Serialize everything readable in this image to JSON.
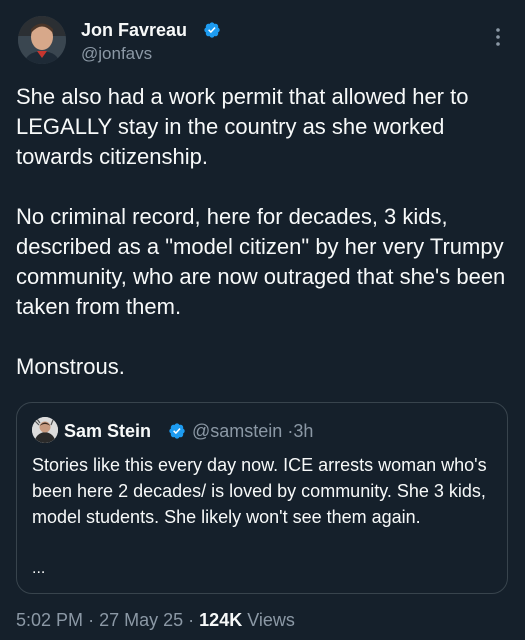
{
  "author": {
    "name": "Jon Favreau",
    "handle": "@jonfavs",
    "avatar_icon": "profile-photo",
    "verified_icon": "verified-badge-icon"
  },
  "tweet": {
    "paragraphs": [
      "She also had a work permit that allowed her to LEGALLY stay in the country as she worked towards citizenship.",
      "No criminal record, here for decades, 3 kids, described as a \"model citizen\" by her very Trumpy community, who are now outraged that she's been taken from them.",
      "Monstrous."
    ]
  },
  "quoted": {
    "name": "Sam Stein",
    "handle": "@samstein",
    "separator": "·",
    "time": "3h",
    "text": "Stories like this every day now. ICE arrests woman who's been here 2 decades/ is loved by community. She 3 kids, model students. She likely won't see them again.",
    "ellipsis": "..."
  },
  "footer": {
    "time": "5:02 PM",
    "separator": "·",
    "date": "27 May 25",
    "views_count": "124K",
    "views_label": "Views"
  },
  "colors": {
    "background": "#15202b",
    "text": "#f7f9f9",
    "secondary": "#8b98a5",
    "verified": "#1d9bf0",
    "border": "#38444d"
  }
}
